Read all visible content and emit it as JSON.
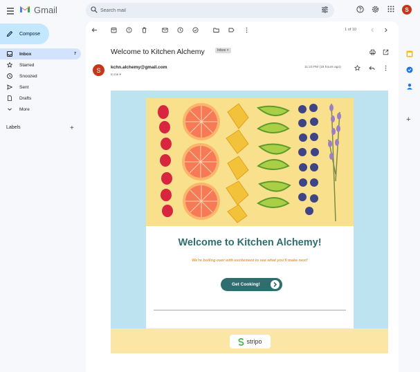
{
  "app": {
    "name": "Gmail"
  },
  "search": {
    "placeholder": "Search mail"
  },
  "user": {
    "initial": "S"
  },
  "sidebar": {
    "compose_label": "Compose",
    "items": [
      {
        "label": "Inbox",
        "count": "7",
        "icon": "inbox-icon"
      },
      {
        "label": "Starred",
        "icon": "star-icon"
      },
      {
        "label": "Snoozed",
        "icon": "clock-icon"
      },
      {
        "label": "Sent",
        "icon": "send-icon"
      },
      {
        "label": "Drafts",
        "icon": "draft-icon"
      },
      {
        "label": "More",
        "icon": "chevron-down-icon"
      }
    ],
    "labels_heading": "Labels"
  },
  "message": {
    "pager": "1 of 10",
    "subject": "Welcome to Kitchen Alchemy",
    "folder_badge": "Inbox ×",
    "sender_initial": "S",
    "sender_email": "kchn.alchemy@gmail.com",
    "to": "to me ▾",
    "time": "11:23 PM (18 hours ago)"
  },
  "email_body": {
    "heading": "Welcome to Kitchen Alchemy!",
    "tagline": "We're boiling over with excitement to see what you'll make next!",
    "cta_label": "Get Cooking!",
    "footer_brand": "stripo"
  },
  "colors": {
    "accent": "#2f6e6e",
    "tagline": "#e59a3a",
    "email_bg": "#bde3f1",
    "hero_bg": "#f9e08d",
    "compose_bg": "#c2e7ff"
  }
}
